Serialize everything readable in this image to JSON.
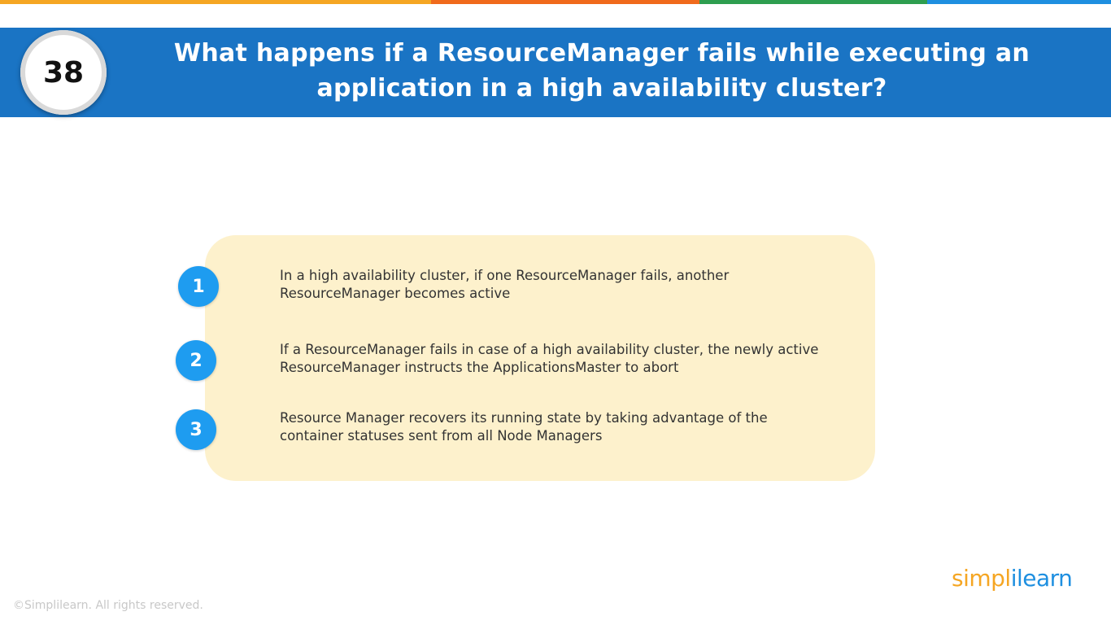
{
  "colors": {
    "header_band": "#1a74c4",
    "panel_background": "#fdf1cc",
    "point_circle": "#1e9cf0",
    "strip": [
      "#f5a623",
      "#f06a1c",
      "#2e9e4f",
      "#1e8fe0"
    ],
    "logo_orange": "#f5a623",
    "logo_blue": "#1e8fe0"
  },
  "header": {
    "number": "38",
    "title": "What happens if a ResourceManager fails while executing an application in a high availability cluster?"
  },
  "points": [
    {
      "number": "1",
      "text": "In a high availability cluster, if one ResourceManager fails, another ResourceManager becomes active"
    },
    {
      "number": "2",
      "text": "If a ResourceManager fails in case of a high availability cluster, the newly active ResourceManager instructs the ApplicationsMaster to abort"
    },
    {
      "number": "3",
      "text": "Resource Manager recovers its running state by taking advantage of the container statuses sent from all Node Managers"
    }
  ],
  "footer": {
    "copyright": "©Simplilearn. All rights reserved.",
    "logo_part1": "simpl",
    "logo_part2": "ilearn"
  }
}
